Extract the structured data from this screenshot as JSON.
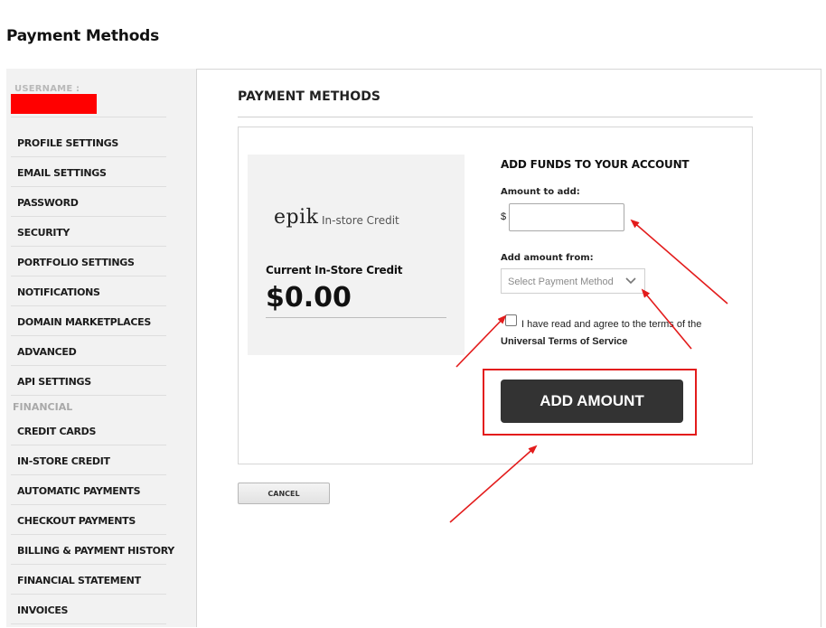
{
  "page": {
    "title": "Payment Methods"
  },
  "sidebar": {
    "username_label": "USERNAME :",
    "items": [
      {
        "label": "PROFILE SETTINGS"
      },
      {
        "label": "EMAIL SETTINGS"
      },
      {
        "label": "PASSWORD"
      },
      {
        "label": "SECURITY"
      },
      {
        "label": "PORTFOLIO SETTINGS"
      },
      {
        "label": "NOTIFICATIONS"
      },
      {
        "label": "DOMAIN MARKETPLACES"
      },
      {
        "label": "ADVANCED"
      },
      {
        "label": "API SETTINGS"
      }
    ],
    "financial_section": "FINANCIAL",
    "financial_items": [
      {
        "label": "CREDIT CARDS"
      },
      {
        "label": "IN-STORE CREDIT"
      },
      {
        "label": "AUTOMATIC PAYMENTS"
      },
      {
        "label": "CHECKOUT PAYMENTS"
      },
      {
        "label": "BILLING & PAYMENT HISTORY"
      },
      {
        "label": "FINANCIAL STATEMENT"
      },
      {
        "label": "INVOICES"
      }
    ]
  },
  "main": {
    "section_title": "PAYMENT METHODS",
    "credit": {
      "logo_text": "epik",
      "logo_subtitle": "In-store Credit",
      "title": "Current In-Store Credit",
      "amount": "$0.00"
    },
    "form": {
      "heading": "ADD FUNDS TO YOUR ACCOUNT",
      "amount_label": "Amount to add:",
      "currency_symbol": "$",
      "amount_value": "",
      "from_label": "Add amount from:",
      "from_placeholder": "Select Payment Method",
      "agree_prefix": "I have read and agree to the terms of the",
      "agree_link": "Universal Terms of Service",
      "agree_checked": false,
      "submit_label": "ADD AMOUNT"
    },
    "cancel_label": "CANCEL"
  },
  "colors": {
    "sidebar_bg": "#f2f2f2",
    "button_dark": "#333333",
    "annotation_red": "#e31c1c",
    "redaction": "#ff0000"
  }
}
